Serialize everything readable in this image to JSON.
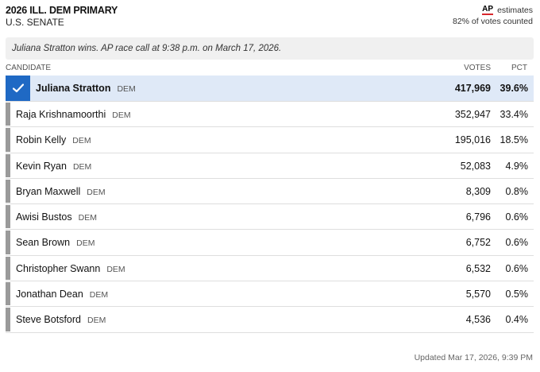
{
  "header": {
    "title": "2026 ILL. DEM PRIMARY",
    "subtitle": "U.S. SENATE",
    "ap_logo": "AP",
    "ap_estimates": "estimates",
    "votes_counted": "82% of votes counted"
  },
  "banner": {
    "text": "Juliana Stratton wins. AP race call at 9:38 p.m. on March 17, 2026."
  },
  "table": {
    "columns": {
      "candidate": "CANDIDATE",
      "votes": "VOTES",
      "pct": "PCT"
    },
    "rows": [
      {
        "name": "Juliana Stratton",
        "party": "DEM",
        "votes": "417,969",
        "pct": "39.6%",
        "winner": true
      },
      {
        "name": "Raja Krishnamoorthi",
        "party": "DEM",
        "votes": "352,947",
        "pct": "33.4%"
      },
      {
        "name": "Robin Kelly",
        "party": "DEM",
        "votes": "195,016",
        "pct": "18.5%"
      },
      {
        "name": "Kevin Ryan",
        "party": "DEM",
        "votes": "52,083",
        "pct": "4.9%"
      },
      {
        "name": "Bryan Maxwell",
        "party": "DEM",
        "votes": "8,309",
        "pct": "0.8%"
      },
      {
        "name": "Awisi Bustos",
        "party": "DEM",
        "votes": "6,796",
        "pct": "0.6%"
      },
      {
        "name": "Sean Brown",
        "party": "DEM",
        "votes": "6,752",
        "pct": "0.6%"
      },
      {
        "name": "Christopher Swann",
        "party": "DEM",
        "votes": "6,532",
        "pct": "0.6%"
      },
      {
        "name": "Jonathan Dean",
        "party": "DEM",
        "votes": "5,570",
        "pct": "0.5%"
      },
      {
        "name": "Steve Botsford",
        "party": "DEM",
        "votes": "4,536",
        "pct": "0.4%"
      }
    ]
  },
  "footer": {
    "updated": "Updated Mar 17, 2026, 9:39 PM"
  },
  "colors": {
    "winner_accent": "#1f69c4",
    "winner_row": "#dfe9f7",
    "ap_red": "#d8272d"
  }
}
